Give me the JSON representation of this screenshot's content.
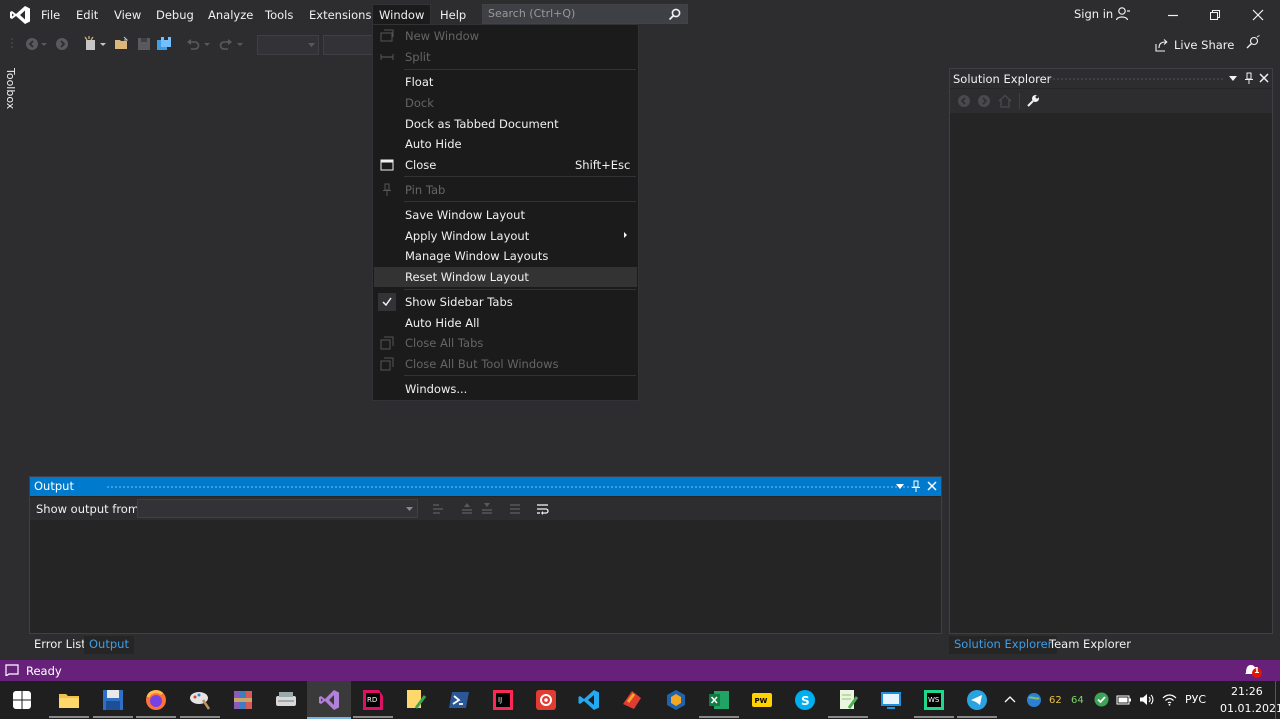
{
  "colors": {
    "accent": "#007acc",
    "status_bar": "#68217a",
    "background": "#2d2d30",
    "menu_bg": "#1b1b1c"
  },
  "menubar": {
    "items": [
      {
        "label": "File"
      },
      {
        "label": "Edit"
      },
      {
        "label": "View"
      },
      {
        "label": "Debug"
      },
      {
        "label": "Analyze"
      },
      {
        "label": "Tools"
      },
      {
        "label": "Extensions"
      },
      {
        "label": "Window"
      },
      {
        "label": "Help"
      }
    ],
    "search_placeholder": "Search (Ctrl+Q)",
    "sign_in": "Sign in"
  },
  "toolbar": {
    "live_share": "Live Share"
  },
  "toolbox": {
    "label": "Toolbox"
  },
  "window_menu": {
    "items": [
      {
        "label": "New Window",
        "enabled": false,
        "icon": "new-window-icon"
      },
      {
        "label": "Split",
        "enabled": false,
        "icon": "split-icon"
      },
      {
        "label": "Float",
        "enabled": true
      },
      {
        "label": "Dock",
        "enabled": false
      },
      {
        "label": "Dock as Tabbed Document",
        "enabled": true
      },
      {
        "label": "Auto Hide",
        "enabled": true
      },
      {
        "label": "Close",
        "enabled": true,
        "shortcut": "Shift+Esc",
        "icon": "close-window-icon"
      },
      {
        "label": "Pin Tab",
        "enabled": false,
        "icon": "pin-icon"
      },
      {
        "label": "Save Window Layout",
        "enabled": true
      },
      {
        "label": "Apply Window Layout",
        "enabled": true,
        "submenu": true
      },
      {
        "label": "Manage Window Layouts",
        "enabled": true
      },
      {
        "label": "Reset Window Layout",
        "enabled": true,
        "highlighted": true
      },
      {
        "label": "Show Sidebar Tabs",
        "enabled": true,
        "checked": true
      },
      {
        "label": "Auto Hide All",
        "enabled": true
      },
      {
        "label": "Close All Tabs",
        "enabled": false,
        "icon": "close-all-tabs-icon"
      },
      {
        "label": "Close All But Tool Windows",
        "enabled": false,
        "icon": "close-all-but-icon"
      },
      {
        "label": "Windows...",
        "enabled": true
      }
    ]
  },
  "output": {
    "title": "Output",
    "show_output_from": "Show output from:",
    "source_value": ""
  },
  "bottom_tabs": {
    "left": [
      {
        "label": "Error List",
        "active": false
      },
      {
        "label": "Output",
        "active": true
      }
    ],
    "right": [
      {
        "label": "Solution Explorer",
        "active": true
      },
      {
        "label": "Team Explorer",
        "active": false
      }
    ]
  },
  "solution_explorer": {
    "title": "Solution Explorer"
  },
  "status": {
    "text": "Ready",
    "notification_count": "1"
  },
  "taskbar": {
    "tray_values": [
      "62",
      "64"
    ],
    "language": "РУС",
    "time": "21:26",
    "date": "01.01.2021"
  }
}
